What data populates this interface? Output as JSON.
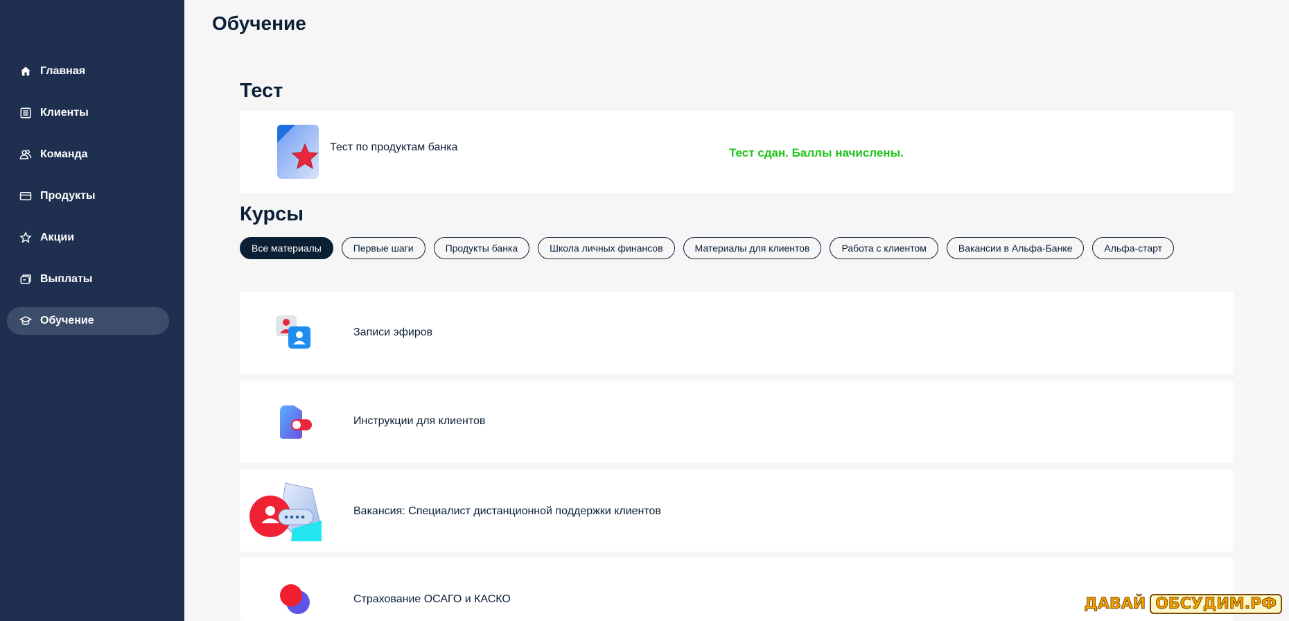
{
  "sidebar": {
    "items": [
      {
        "label": "Главная",
        "icon": "home-icon"
      },
      {
        "label": "Клиенты",
        "icon": "list-icon"
      },
      {
        "label": "Команда",
        "icon": "team-icon"
      },
      {
        "label": "Продукты",
        "icon": "card-icon"
      },
      {
        "label": "Акции",
        "icon": "star-icon"
      },
      {
        "label": "Выплаты",
        "icon": "payouts-icon"
      },
      {
        "label": "Обучение",
        "icon": "graduation-cap-icon",
        "active": true
      }
    ]
  },
  "page": {
    "title": "Обучение"
  },
  "test_section": {
    "title": "Тест",
    "card": {
      "label": "Тест по продуктам банка",
      "status": "Тест сдан. Баллы начислены.",
      "status_color": "#22c31a"
    }
  },
  "courses_section": {
    "title": "Курсы",
    "filters": [
      {
        "label": "Все материалы",
        "active": true
      },
      {
        "label": "Первые шаги"
      },
      {
        "label": "Продукты банка"
      },
      {
        "label": "Школа личных финансов"
      },
      {
        "label": "Материалы для клиентов"
      },
      {
        "label": "Работа с клиентом"
      },
      {
        "label": "Вакансии в Альфа-Банке"
      },
      {
        "label": "Альфа-старт"
      }
    ],
    "items": [
      {
        "label": "Записи эфиров",
        "icon": "broadcast-recordings-icon"
      },
      {
        "label": "Инструкции для клиентов",
        "icon": "toggle-instructions-icon"
      },
      {
        "label": "Вакансия: Специалист дистанционной поддержки клиентов",
        "icon": "support-chat-icon"
      },
      {
        "label": "Страхование ОСАГО и КАСКО",
        "icon": "insurance-circles-icon"
      }
    ]
  },
  "watermark": {
    "part1": "ДАВАЙ",
    "part2": "ОБСУДИМ.РФ"
  },
  "colors": {
    "sidebar_bg": "#1e2f4f",
    "active_item_bg": "#3c4d6b",
    "accent_green": "#22c31a",
    "text_dark": "#0b1f35"
  }
}
